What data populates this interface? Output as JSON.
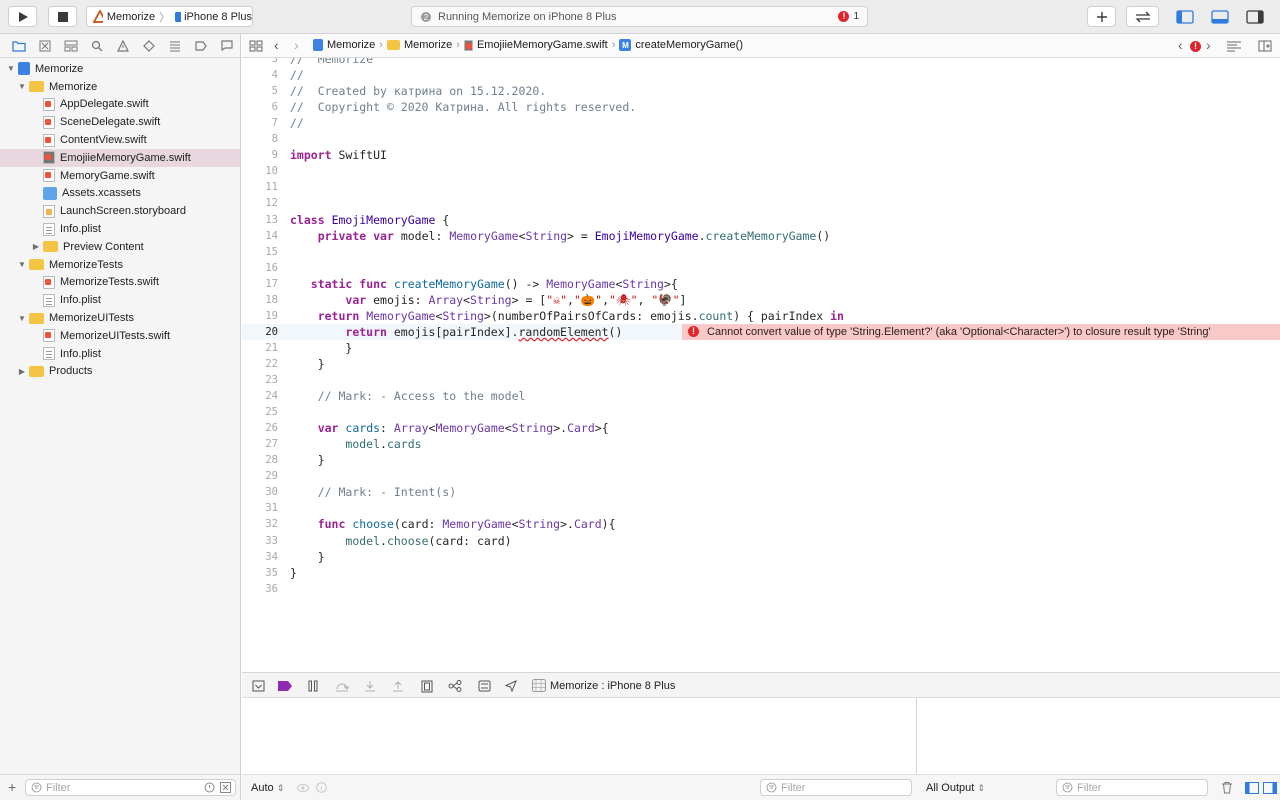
{
  "toolbar": {
    "scheme_name": "Memorize",
    "device_name": "iPhone 8 Plus",
    "activity_text": "Running Memorize on iPhone 8 Plus",
    "error_count": "1"
  },
  "navigator": {
    "filter_placeholder": "Filter",
    "tree": [
      {
        "label": "Memorize",
        "icon": "project-icon",
        "depth": 0,
        "disclosure": "open"
      },
      {
        "label": "Memorize",
        "icon": "folder-icon",
        "depth": 1,
        "disclosure": "open"
      },
      {
        "label": "AppDelegate.swift",
        "icon": "swift-file-icon",
        "depth": 2
      },
      {
        "label": "SceneDelegate.swift",
        "icon": "swift-file-icon",
        "depth": 2
      },
      {
        "label": "ContentView.swift",
        "icon": "swift-file-icon",
        "depth": 2
      },
      {
        "label": "EmojiieMemoryGame.swift",
        "icon": "swift-file-icon",
        "depth": 2,
        "selected": true
      },
      {
        "label": "MemoryGame.swift",
        "icon": "swift-file-icon",
        "depth": 2
      },
      {
        "label": "Assets.xcassets",
        "icon": "asset-catalog-icon",
        "depth": 2
      },
      {
        "label": "LaunchScreen.storyboard",
        "icon": "storyboard-icon",
        "depth": 2
      },
      {
        "label": "Info.plist",
        "icon": "plist-icon",
        "depth": 2
      },
      {
        "label": "Preview Content",
        "icon": "folder-icon",
        "depth": 2,
        "disclosure": "closed"
      },
      {
        "label": "MemorizeTests",
        "icon": "folder-icon",
        "depth": 1,
        "disclosure": "open"
      },
      {
        "label": "MemorizeTests.swift",
        "icon": "swift-file-icon",
        "depth": 2
      },
      {
        "label": "Info.plist",
        "icon": "plist-icon",
        "depth": 2
      },
      {
        "label": "MemorizeUITests",
        "icon": "folder-icon",
        "depth": 1,
        "disclosure": "open"
      },
      {
        "label": "MemorizeUITests.swift",
        "icon": "swift-file-icon",
        "depth": 2
      },
      {
        "label": "Info.plist",
        "icon": "plist-icon",
        "depth": 2
      },
      {
        "label": "Products",
        "icon": "folder-icon",
        "depth": 1,
        "disclosure": "closed"
      }
    ]
  },
  "jumpbar": {
    "crumbs": [
      "Memorize",
      "Memorize",
      "EmojiieMemoryGame.swift",
      "createMemoryGame()"
    ]
  },
  "editor": {
    "current_line": 20,
    "error_line": 20,
    "error_message": "Cannot convert value of type 'String.Element?' (aka 'Optional<Character>') to closure result type 'String'",
    "lines": [
      {
        "n": 3,
        "tokens": [
          [
            "c",
            "//  Memorize"
          ]
        ]
      },
      {
        "n": 4,
        "tokens": [
          [
            "c",
            "//"
          ]
        ]
      },
      {
        "n": 5,
        "tokens": [
          [
            "c",
            "//  Created by катрина on 15.12.2020."
          ]
        ]
      },
      {
        "n": 6,
        "tokens": [
          [
            "c",
            "//  Copyright © 2020 Катрина. All rights reserved."
          ]
        ]
      },
      {
        "n": 7,
        "tokens": [
          [
            "c",
            "//"
          ]
        ]
      },
      {
        "n": 8,
        "tokens": []
      },
      {
        "n": 9,
        "tokens": [
          [
            "k",
            "import"
          ],
          [
            "",
            " SwiftUI"
          ]
        ]
      },
      {
        "n": 10,
        "tokens": []
      },
      {
        "n": 11,
        "tokens": []
      },
      {
        "n": 12,
        "tokens": []
      },
      {
        "n": 13,
        "tokens": [
          [
            "k",
            "class"
          ],
          [
            "",
            " "
          ],
          [
            "t",
            "EmojiMemoryGame"
          ],
          [
            "",
            " {"
          ]
        ]
      },
      {
        "n": 14,
        "tokens": [
          [
            "",
            "    "
          ],
          [
            "k",
            "private"
          ],
          [
            "",
            " "
          ],
          [
            "k",
            "var"
          ],
          [
            "",
            " "
          ],
          [
            "",
            "model"
          ],
          [
            "",
            ": "
          ],
          [
            "p",
            "MemoryGame"
          ],
          [
            "",
            "<"
          ],
          [
            "p",
            "String"
          ],
          [
            "",
            "> = "
          ],
          [
            "t",
            "EmojiMemoryGame"
          ],
          [
            "",
            "."
          ],
          [
            "m",
            "createMemoryGame"
          ],
          [
            "",
            "()"
          ]
        ]
      },
      {
        "n": 15,
        "tokens": []
      },
      {
        "n": 16,
        "tokens": []
      },
      {
        "n": 17,
        "tokens": [
          [
            "",
            "   "
          ],
          [
            "k",
            "static"
          ],
          [
            "",
            " "
          ],
          [
            "k",
            "func"
          ],
          [
            "",
            " "
          ],
          [
            "fn",
            "createMemoryGame"
          ],
          [
            "",
            "() -> "
          ],
          [
            "p",
            "MemoryGame"
          ],
          [
            "",
            "<"
          ],
          [
            "p",
            "String"
          ],
          [
            "",
            ">{"
          ]
        ]
      },
      {
        "n": 18,
        "tokens": [
          [
            "",
            "        "
          ],
          [
            "k",
            "var"
          ],
          [
            "",
            " emojis: "
          ],
          [
            "p",
            "Array"
          ],
          [
            "",
            "<"
          ],
          [
            "p",
            "String"
          ],
          [
            "",
            "> = ["
          ],
          [
            "s",
            "\"☠\""
          ],
          [
            "",
            ","
          ],
          [
            "s",
            "\"🎃\""
          ],
          [
            "",
            ","
          ],
          [
            "s",
            "\"🕷\""
          ],
          [
            "",
            ", "
          ],
          [
            "s",
            "\"🦃\""
          ],
          [
            "",
            "]"
          ]
        ]
      },
      {
        "n": 19,
        "tokens": [
          [
            "",
            "    "
          ],
          [
            "k",
            "return"
          ],
          [
            "",
            " "
          ],
          [
            "p",
            "MemoryGame"
          ],
          [
            "",
            "<"
          ],
          [
            "p",
            "String"
          ],
          [
            "",
            ">(numberOfPairsOfCards: emojis."
          ],
          [
            "m",
            "count"
          ],
          [
            "",
            ") { pairIndex "
          ],
          [
            "k",
            "in"
          ]
        ]
      },
      {
        "n": 20,
        "tokens": [
          [
            "",
            "        "
          ],
          [
            "k",
            "return"
          ],
          [
            "",
            " emojis[pairIndex]."
          ],
          [
            "",
            "randomElement"
          ],
          [
            "",
            "()"
          ]
        ]
      },
      {
        "n": 21,
        "tokens": [
          [
            "",
            "        }"
          ]
        ]
      },
      {
        "n": 22,
        "tokens": [
          [
            "",
            "    }"
          ]
        ]
      },
      {
        "n": 23,
        "tokens": []
      },
      {
        "n": 24,
        "tokens": [
          [
            "",
            "    "
          ],
          [
            "c",
            "// Mark: - Access to the model"
          ]
        ]
      },
      {
        "n": 25,
        "tokens": []
      },
      {
        "n": 26,
        "tokens": [
          [
            "",
            "    "
          ],
          [
            "k",
            "var"
          ],
          [
            "",
            " "
          ],
          [
            "fn",
            "cards"
          ],
          [
            "",
            ": "
          ],
          [
            "p",
            "Array"
          ],
          [
            "",
            "<"
          ],
          [
            "p",
            "MemoryGame"
          ],
          [
            "",
            "<"
          ],
          [
            "p",
            "String"
          ],
          [
            "",
            ">."
          ],
          [
            "p",
            "Card"
          ],
          [
            "",
            ">{"
          ]
        ]
      },
      {
        "n": 27,
        "tokens": [
          [
            "",
            "        "
          ],
          [
            "m",
            "model"
          ],
          [
            "",
            "."
          ],
          [
            "m",
            "cards"
          ]
        ]
      },
      {
        "n": 28,
        "tokens": [
          [
            "",
            "    }"
          ]
        ]
      },
      {
        "n": 29,
        "tokens": []
      },
      {
        "n": 30,
        "tokens": [
          [
            "",
            "    "
          ],
          [
            "c",
            "// Mark: - Intent(s)"
          ]
        ]
      },
      {
        "n": 31,
        "tokens": []
      },
      {
        "n": 32,
        "tokens": [
          [
            "",
            "    "
          ],
          [
            "k",
            "func"
          ],
          [
            "",
            " "
          ],
          [
            "fn",
            "choose"
          ],
          [
            "",
            "(card: "
          ],
          [
            "p",
            "MemoryGame"
          ],
          [
            "",
            "<"
          ],
          [
            "p",
            "String"
          ],
          [
            "",
            ">."
          ],
          [
            "p",
            "Card"
          ],
          [
            "",
            "){"
          ]
        ]
      },
      {
        "n": 33,
        "tokens": [
          [
            "",
            "        "
          ],
          [
            "m",
            "model"
          ],
          [
            "",
            "."
          ],
          [
            "m",
            "choose"
          ],
          [
            "",
            "(card: card)"
          ]
        ]
      },
      {
        "n": 34,
        "tokens": [
          [
            "",
            "    }"
          ]
        ]
      },
      {
        "n": 35,
        "tokens": [
          [
            "",
            "}"
          ]
        ]
      },
      {
        "n": 36,
        "tokens": []
      }
    ]
  },
  "debug": {
    "process_label": "Memorize : iPhone 8 Plus",
    "variables_mode": "Auto",
    "variables_filter_placeholder": "Filter",
    "output_mode": "All Output",
    "console_filter_placeholder": "Filter"
  },
  "colors": {
    "error": "#e0252b",
    "error_banner": "#f8c9c7",
    "selection": "#e8d7df",
    "keyword": "#9b2393",
    "comment": "#707f8c"
  }
}
